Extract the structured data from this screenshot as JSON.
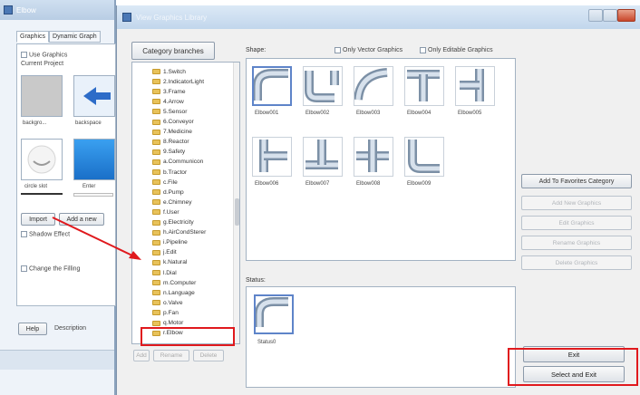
{
  "back_window": {
    "title": "Elbow",
    "tabs": [
      {
        "label": "Graphics"
      },
      {
        "label": "Dynamic Graph"
      }
    ],
    "use_graphics": "Use Graphics",
    "current_project": "Current Project",
    "thumbs": [
      {
        "label": "backgro..."
      },
      {
        "label": "backspace"
      },
      {
        "label": "circle slot"
      },
      {
        "label": "Enter"
      }
    ],
    "import_label": "Import",
    "add_new_label": "Add a new",
    "shadow_effect": "Shadow Effect",
    "change_filling": "Change the Filling",
    "help_label": "Help",
    "description_label": "Description"
  },
  "dialog": {
    "title": "View Graphics Library",
    "category_button": "Category branches",
    "shape_label": "Shape:",
    "only_vector": "Only Vector Graphics",
    "only_editable": "Only Editable Graphics",
    "tree_items": [
      {
        "label": "1.Switch"
      },
      {
        "label": "2.IndicatorLight"
      },
      {
        "label": "3.Frame"
      },
      {
        "label": "4.Arrow"
      },
      {
        "label": "5.Sensor"
      },
      {
        "label": "6.Conveyor"
      },
      {
        "label": "7.Medicine"
      },
      {
        "label": "8.Reactor"
      },
      {
        "label": "9.Safety"
      },
      {
        "label": "a.Communicon"
      },
      {
        "label": "b.Tractor"
      },
      {
        "label": "c.File"
      },
      {
        "label": "d.Pump"
      },
      {
        "label": "e.Chimney"
      },
      {
        "label": "f.User"
      },
      {
        "label": "g.Electricity"
      },
      {
        "label": "h.AirCondSterer"
      },
      {
        "label": "i.Pipeline"
      },
      {
        "label": "j.Edit"
      },
      {
        "label": "k.Natural"
      },
      {
        "label": "l.Dial"
      },
      {
        "label": "m.Computer"
      },
      {
        "label": "n.Language"
      },
      {
        "label": "o.Valve"
      },
      {
        "label": "p.Fan"
      },
      {
        "label": "q.Motor"
      },
      {
        "label": "r.Elbow"
      }
    ],
    "tree_buttons": [
      {
        "label": "Add"
      },
      {
        "label": "Rename"
      },
      {
        "label": "Delete"
      }
    ],
    "shapes": [
      {
        "label": "Elbow001",
        "icon": "elbow-corner-icon"
      },
      {
        "label": "Elbow002",
        "icon": "elbow-u-icon"
      },
      {
        "label": "Elbow003",
        "icon": "elbow-curve-icon"
      },
      {
        "label": "Elbow004",
        "icon": "elbow-tee-icon"
      },
      {
        "label": "Elbow005",
        "icon": "elbow-side-tee-icon"
      },
      {
        "label": "Elbow006",
        "icon": "elbow-left-tee-icon"
      },
      {
        "label": "Elbow007",
        "icon": "elbow-bottom-tee-icon"
      },
      {
        "label": "Elbow008",
        "icon": "elbow-cross-icon"
      },
      {
        "label": "Elbow009",
        "icon": "elbow-l-icon"
      }
    ],
    "right_buttons": [
      {
        "label": "Add To Favorites Category",
        "enabled": true
      },
      {
        "label": "Add New Graphics",
        "enabled": false
      },
      {
        "label": "Edit Graphics",
        "enabled": false
      },
      {
        "label": "Rename Graphics",
        "enabled": false
      },
      {
        "label": "Delete Graphics",
        "enabled": false
      }
    ],
    "status_label": "Status:",
    "status_item": {
      "label": "Status0"
    },
    "exit_label": "Exit",
    "select_exit_label": "Select and Exit"
  },
  "colors": {
    "highlight": "#e0191d",
    "pipe": "#8fa3b8",
    "folder": "#e8c25a"
  }
}
